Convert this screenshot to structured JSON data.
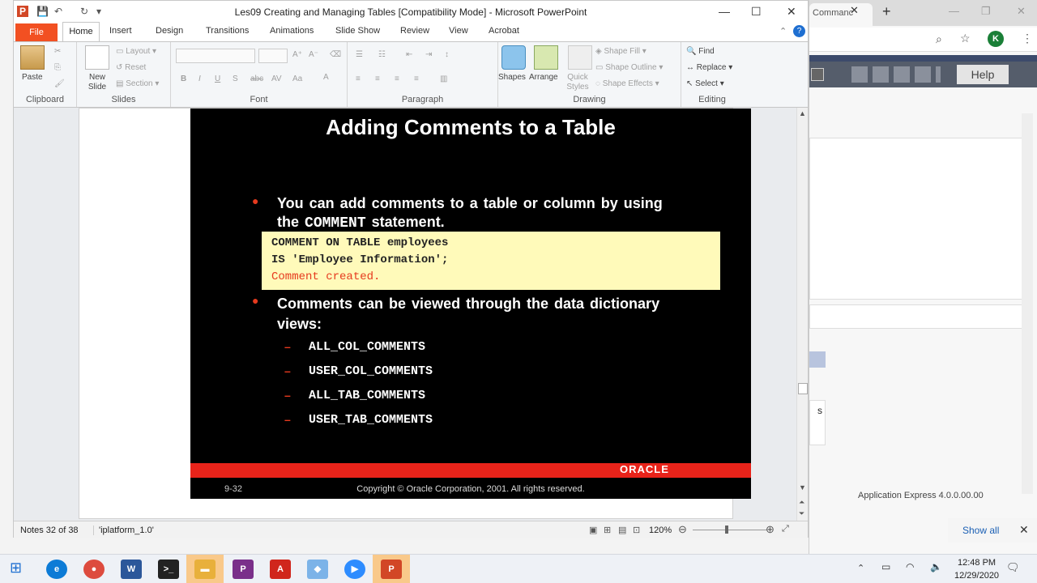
{
  "window": {
    "title": "Les09 Creating and Managing Tables [Compatibility Mode] - Microsoft PowerPoint"
  },
  "ribbon_tabs": [
    "File",
    "Home",
    "Insert",
    "Design",
    "Transitions",
    "Animations",
    "Slide Show",
    "Review",
    "View",
    "Acrobat"
  ],
  "ribbon": {
    "clipboard": {
      "label": "Clipboard",
      "paste": "Paste"
    },
    "slides": {
      "label": "Slides",
      "new_slide": "New Slide",
      "layout": "Layout",
      "reset": "Reset",
      "section": "Section"
    },
    "font": {
      "label": "Font"
    },
    "paragraph": {
      "label": "Paragraph"
    },
    "drawing": {
      "label": "Drawing",
      "shapes": "Shapes",
      "arrange": "Arrange",
      "quick_styles": "Quick Styles",
      "shape_fill": "Shape Fill",
      "shape_outline": "Shape Outline",
      "shape_effects": "Shape Effects"
    },
    "editing": {
      "label": "Editing",
      "find": "Find",
      "replace": "Replace",
      "select": "Select"
    }
  },
  "slide": {
    "title": "Adding Comments to a Table",
    "bullet1_line1": "You can add comments to a table or column by using",
    "bullet1_line2_pre": "the",
    "bullet1_code": "COMMENT",
    "bullet1_line2_post": "statement.",
    "code_line1": "COMMENT ON TABLE employees",
    "code_line2": "IS 'Employee Information';",
    "code_result": "Comment created.",
    "bullet2_line1": "Comments can be viewed through the data dictionary",
    "bullet2_line2": "views:",
    "views": [
      "ALL_COL_COMMENTS",
      "USER_COL_COMMENTS",
      "ALL_TAB_COMMENTS",
      "USER_TAB_COMMENTS"
    ],
    "brand": "ORACLE",
    "slide_number": "9-32",
    "copyright": "Copyright © Oracle Corporation, 2001. All rights reserved."
  },
  "status": {
    "notes": "Notes 32 of 38",
    "theme": "'iplatform_1.0'",
    "zoom": "120%"
  },
  "browser": {
    "tab_label": "Commanc",
    "help": "Help",
    "avatar": "K",
    "show_all": "Show all",
    "footer_text": "Application Express 4.0.0.00.00"
  },
  "taskbar": {
    "time": "12:48 PM",
    "date": "12/29/2020"
  },
  "colors": {
    "file_tab": "#f25022",
    "slide_bg": "#000000",
    "code_bg": "#fffaba",
    "bullet_red": "#e63a1e",
    "oracle_bar": "#e8231a"
  }
}
